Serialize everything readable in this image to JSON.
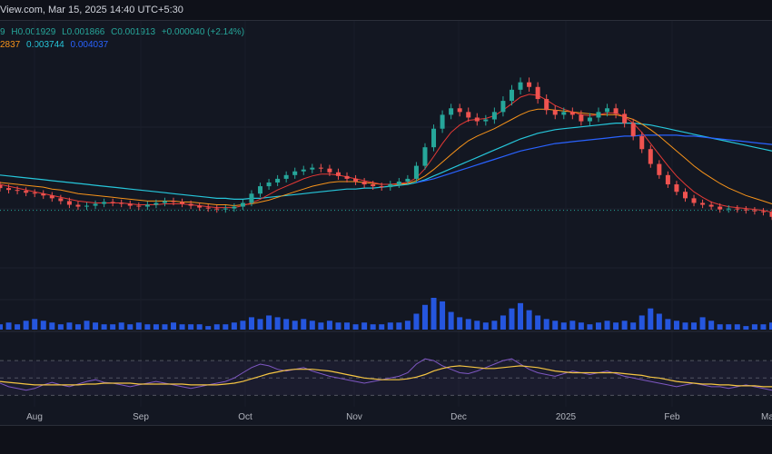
{
  "header": {
    "source_line": "View.com, Mar 15, 2025 14:40 UTC+5:30"
  },
  "legend": {
    "ohlc_prefix": "9",
    "high": "H0.001929",
    "low": "L0.001866",
    "close": "C0.001913",
    "change": "+0.000040 (+2.14%)",
    "ma_values": [
      {
        "text": "2837",
        "color": "#f7931a"
      },
      {
        "text": "0.003744",
        "color": "#26c6da"
      },
      {
        "text": "0.004037",
        "color": "#2962ff"
      }
    ]
  },
  "colors": {
    "up": "#26a69a",
    "down": "#ef5350",
    "volume": "#2962ff",
    "rsi": "#7e57c2",
    "rsi_ma": "#f5c542",
    "ma_fast": "#e53935",
    "ma_mid": "#f7931a",
    "ma_slow": "#26c6da",
    "ma_long": "#2962ff"
  },
  "chart_data": {
    "type": "candlestick",
    "x_ticks": [
      "Aug",
      "Sep",
      "Oct",
      "Nov",
      "Dec",
      "2025",
      "Feb",
      "Ma"
    ],
    "price": {
      "closes": [
        0.00316,
        0.00314,
        0.00313,
        0.00311,
        0.0031,
        0.00308,
        0.00305,
        0.00302,
        0.00298,
        0.00296,
        0.00297,
        0.00299,
        0.00301,
        0.003,
        0.00299,
        0.00297,
        0.00296,
        0.00298,
        0.003,
        0.00302,
        0.00301,
        0.00299,
        0.00297,
        0.00295,
        0.00294,
        0.00293,
        0.00294,
        0.00296,
        0.003,
        0.0031,
        0.00318,
        0.00322,
        0.00326,
        0.0033,
        0.00334,
        0.00336,
        0.00338,
        0.00337,
        0.00333,
        0.00329,
        0.00326,
        0.00323,
        0.0032,
        0.00318,
        0.00317,
        0.0032,
        0.00323,
        0.00326,
        0.0034,
        0.0036,
        0.0038,
        0.00395,
        0.00402,
        0.00398,
        0.00392,
        0.00388,
        0.0039,
        0.00398,
        0.0041,
        0.00422,
        0.0043,
        0.00425,
        0.00412,
        0.004,
        0.00395,
        0.00398,
        0.00395,
        0.00388,
        0.00392,
        0.00398,
        0.00402,
        0.00396,
        0.00386,
        0.00372,
        0.00358,
        0.00342,
        0.0033,
        0.0032,
        0.00312,
        0.00305,
        0.003,
        0.00298,
        0.00296,
        0.00293,
        0.00294,
        0.00293,
        0.00292,
        0.00291,
        0.0029,
        0.00285
      ],
      "ma_fast": [
        0.0032,
        0.00318,
        0.00316,
        0.00314,
        0.00312,
        0.0031,
        0.00308,
        0.00306,
        0.00304,
        0.00302,
        0.00301,
        0.003,
        0.003,
        0.003,
        0.003,
        0.00299,
        0.00298,
        0.00298,
        0.00298,
        0.00299,
        0.00299,
        0.00299,
        0.00298,
        0.00297,
        0.00296,
        0.00295,
        0.00295,
        0.00295,
        0.00297,
        0.003,
        0.00304,
        0.00309,
        0.00314,
        0.00318,
        0.00322,
        0.00326,
        0.00329,
        0.00331,
        0.00331,
        0.0033,
        0.00328,
        0.00326,
        0.00324,
        0.00322,
        0.0032,
        0.0032,
        0.00321,
        0.00322,
        0.00327,
        0.00337,
        0.0035,
        0.00364,
        0.00376,
        0.00384,
        0.00389,
        0.0039,
        0.00391,
        0.00394,
        0.004,
        0.00407,
        0.00414,
        0.00417,
        0.00416,
        0.00411,
        0.00405,
        0.00401,
        0.00398,
        0.00395,
        0.00394,
        0.00395,
        0.00397,
        0.00397,
        0.00393,
        0.00386,
        0.00376,
        0.00364,
        0.00352,
        0.0034,
        0.00329,
        0.0032,
        0.00312,
        0.00306,
        0.00301,
        0.00298,
        0.00296,
        0.00295,
        0.00294,
        0.00293,
        0.00292,
        0.0029
      ],
      "ma_mid": [
        0.00322,
        0.00321,
        0.0032,
        0.00319,
        0.00318,
        0.00317,
        0.00315,
        0.00314,
        0.00312,
        0.0031,
        0.00309,
        0.00308,
        0.00307,
        0.00306,
        0.00305,
        0.00304,
        0.00303,
        0.00302,
        0.00302,
        0.00302,
        0.00302,
        0.00301,
        0.00301,
        0.003,
        0.00299,
        0.00298,
        0.00298,
        0.00297,
        0.00298,
        0.00299,
        0.00301,
        0.00303,
        0.00306,
        0.00309,
        0.00312,
        0.00315,
        0.00318,
        0.0032,
        0.00322,
        0.00323,
        0.00323,
        0.00323,
        0.00322,
        0.00321,
        0.0032,
        0.0032,
        0.0032,
        0.00321,
        0.00324,
        0.00329,
        0.00336,
        0.00344,
        0.00352,
        0.0036,
        0.00367,
        0.00372,
        0.00376,
        0.0038,
        0.00385,
        0.0039,
        0.00395,
        0.00399,
        0.00401,
        0.00401,
        0.004,
        0.00399,
        0.00398,
        0.00397,
        0.00396,
        0.00395,
        0.00395,
        0.00395,
        0.00393,
        0.0039,
        0.00385,
        0.00379,
        0.00372,
        0.00364,
        0.00356,
        0.00348,
        0.0034,
        0.00333,
        0.00327,
        0.00321,
        0.00316,
        0.00312,
        0.00308,
        0.00305,
        0.00302,
        0.00299
      ],
      "ma_slow": [
        0.0033,
        0.00329,
        0.00328,
        0.00327,
        0.00326,
        0.00325,
        0.00324,
        0.00323,
        0.00322,
        0.00321,
        0.0032,
        0.00319,
        0.00318,
        0.00317,
        0.00316,
        0.00315,
        0.00314,
        0.00313,
        0.00312,
        0.00311,
        0.0031,
        0.00309,
        0.00308,
        0.00307,
        0.00306,
        0.00305,
        0.00305,
        0.00304,
        0.00304,
        0.00305,
        0.00305,
        0.00306,
        0.00307,
        0.00308,
        0.00309,
        0.0031,
        0.00311,
        0.00312,
        0.00313,
        0.00314,
        0.00315,
        0.00315,
        0.00316,
        0.00316,
        0.00317,
        0.00318,
        0.00319,
        0.0032,
        0.00322,
        0.00325,
        0.00329,
        0.00333,
        0.00337,
        0.00341,
        0.00345,
        0.00349,
        0.00353,
        0.00357,
        0.00361,
        0.00365,
        0.00369,
        0.00372,
        0.00375,
        0.00377,
        0.00379,
        0.0038,
        0.00381,
        0.00382,
        0.00383,
        0.00384,
        0.00385,
        0.00386,
        0.00386,
        0.00386,
        0.00385,
        0.00384,
        0.00382,
        0.0038,
        0.00378,
        0.00376,
        0.00374,
        0.00372,
        0.0037,
        0.00368,
        0.00366,
        0.00364,
        0.00362,
        0.0036,
        0.00358,
        0.00356
      ],
      "ma_long": [
        null,
        null,
        null,
        null,
        null,
        null,
        null,
        null,
        null,
        null,
        null,
        null,
        null,
        null,
        null,
        null,
        null,
        null,
        null,
        null,
        null,
        null,
        null,
        null,
        null,
        null,
        null,
        null,
        null,
        null,
        null,
        null,
        null,
        null,
        null,
        null,
        null,
        null,
        null,
        null,
        null,
        null,
        null,
        null,
        null,
        null,
        null,
        null,
        0.00322,
        0.00324,
        0.00326,
        0.00329,
        0.00332,
        0.00335,
        0.00338,
        0.00341,
        0.00344,
        0.00347,
        0.0035,
        0.00353,
        0.00356,
        0.00358,
        0.0036,
        0.00362,
        0.00364,
        0.00365,
        0.00366,
        0.00367,
        0.00368,
        0.00369,
        0.0037,
        0.00371,
        0.00372,
        0.00372,
        0.00373,
        0.00373,
        0.00373,
        0.00373,
        0.00373,
        0.00372,
        0.00372,
        0.00371,
        0.0037,
        0.00369,
        0.00368,
        0.00367,
        0.00366,
        0.00365,
        0.00364,
        0.00363
      ],
      "last_price_level": 0.00292,
      "ylim": [
        0.0023,
        0.0046
      ]
    },
    "volume": [
      3,
      4,
      3,
      5,
      6,
      5,
      4,
      3,
      4,
      3,
      5,
      4,
      3,
      3,
      4,
      3,
      4,
      3,
      3,
      3,
      4,
      3,
      3,
      3,
      2,
      3,
      3,
      4,
      5,
      7,
      6,
      8,
      7,
      6,
      5,
      6,
      5,
      4,
      5,
      4,
      4,
      3,
      4,
      3,
      3,
      4,
      4,
      5,
      9,
      14,
      18,
      16,
      10,
      7,
      6,
      5,
      4,
      5,
      8,
      12,
      15,
      11,
      8,
      6,
      5,
      4,
      5,
      4,
      3,
      4,
      5,
      4,
      5,
      4,
      8,
      12,
      9,
      6,
      5,
      4,
      4,
      7,
      5,
      3,
      3,
      3,
      2,
      3,
      3,
      4
    ],
    "rsi": [
      44,
      40,
      38,
      36,
      38,
      42,
      45,
      42,
      40,
      43,
      46,
      48,
      45,
      44,
      42,
      40,
      42,
      44,
      46,
      44,
      42,
      40,
      38,
      40,
      42,
      44,
      46,
      50,
      56,
      62,
      66,
      64,
      60,
      58,
      60,
      62,
      58,
      55,
      52,
      50,
      48,
      46,
      44,
      46,
      48,
      50,
      52,
      56,
      66,
      72,
      70,
      64,
      60,
      56,
      55,
      58,
      62,
      66,
      70,
      72,
      66,
      60,
      56,
      54,
      52,
      55,
      58,
      56,
      54,
      56,
      58,
      55,
      52,
      50,
      48,
      46,
      44,
      42,
      40,
      42,
      44,
      42,
      40,
      40,
      38,
      40,
      42,
      40,
      38,
      36
    ],
    "rsi_ma": [
      46,
      45,
      44,
      43,
      42,
      42,
      42,
      42,
      42,
      42,
      43,
      43,
      44,
      44,
      44,
      44,
      43,
      43,
      43,
      43,
      43,
      43,
      42,
      42,
      42,
      42,
      43,
      44,
      46,
      49,
      52,
      55,
      57,
      59,
      60,
      60,
      60,
      59,
      58,
      56,
      54,
      52,
      50,
      49,
      48,
      48,
      48,
      49,
      51,
      54,
      58,
      61,
      63,
      64,
      63,
      62,
      61,
      61,
      62,
      63,
      64,
      63,
      62,
      60,
      58,
      57,
      56,
      56,
      56,
      56,
      56,
      56,
      55,
      54,
      53,
      51,
      50,
      48,
      46,
      45,
      44,
      43,
      43,
      42,
      42,
      41,
      41,
      41,
      40,
      40
    ],
    "rsi_bands": [
      70,
      50,
      30
    ]
  }
}
